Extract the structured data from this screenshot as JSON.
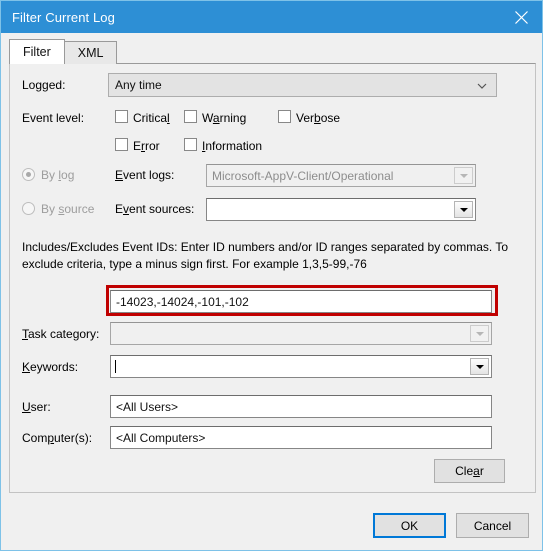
{
  "window": {
    "title": "Filter Current Log",
    "close_icon": "close-icon"
  },
  "tabs": [
    {
      "label": "Filter",
      "active": true
    },
    {
      "label": "XML",
      "active": false
    }
  ],
  "form": {
    "logged": {
      "label": "Logged:",
      "label_accel": "g",
      "value": "Any time",
      "icon": "chevron-down-icon"
    },
    "event_level": {
      "label": "Event level:",
      "options": [
        {
          "label": "Critical",
          "checked": false,
          "accel": ""
        },
        {
          "label": "Warning",
          "checked": false,
          "accel": "a"
        },
        {
          "label": "Verbose",
          "checked": false,
          "accel": "b"
        },
        {
          "label": "Error",
          "checked": false,
          "accel": "r"
        },
        {
          "label": "Information",
          "checked": false,
          "accel": "I"
        }
      ]
    },
    "by_log": {
      "radio_label": "By log",
      "radio_accel": "l",
      "selected": true,
      "enabled": false,
      "field_label": "Event logs:",
      "field_accel": "E",
      "value": "Microsoft-AppV-Client/Operational",
      "icon": "dropdown-arrow-icon"
    },
    "by_source": {
      "radio_label": "By source",
      "radio_accel": "s",
      "selected": false,
      "enabled": false,
      "field_label": "Event sources:",
      "field_accel": "v",
      "value": "",
      "icon": "dropdown-arrow-icon"
    },
    "event_ids": {
      "description_line1": "Includes/Excludes Event IDs: Enter ID numbers and/or ID ranges separated by commas. To",
      "description_line2": "exclude criteria, type a minus sign first. For example 1,3,5-99,-76",
      "value": "-14023,-14024,-101,-102",
      "highlighted": true,
      "highlight_color": "#c00000"
    },
    "task_category": {
      "label": "Task category:",
      "label_accel": "T",
      "value": "",
      "enabled": false,
      "icon": "dropdown-arrow-icon"
    },
    "keywords": {
      "label": "Keywords:",
      "label_accel": "K",
      "value": "",
      "enabled": true,
      "icon": "dropdown-arrow-icon"
    },
    "user": {
      "label": "User:",
      "label_accel": "U",
      "value": "<All Users>"
    },
    "computers": {
      "label": "Computer(s):",
      "label_accel": "p",
      "value": "<All Computers>"
    },
    "clear_button": {
      "label": "Clear",
      "accel": "a"
    }
  },
  "footer": {
    "ok_label": "OK",
    "cancel_label": "Cancel",
    "default_button": "OK",
    "focus_color": "#0078d7"
  },
  "theme": {
    "titlebar_color": "#2d8fd5",
    "dialog_background": "#f0f0f0",
    "border_color": "#7ec2e8"
  }
}
